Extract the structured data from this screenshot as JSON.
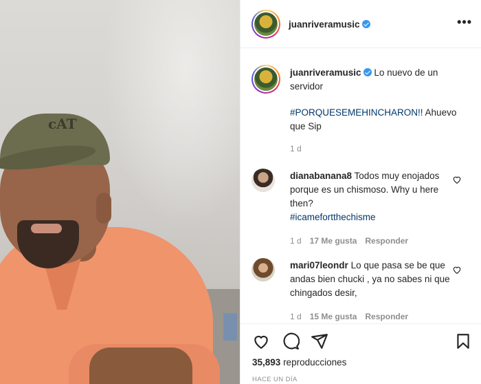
{
  "post": {
    "username": "juanriveramusic",
    "more_label": "•••"
  },
  "caption": {
    "username": "juanriveramusic",
    "text": "Lo nuevo de un servidor",
    "hashtag": "#PORQUESEMEHINCHARON!!",
    "text_after": "Ahuevo que Sip",
    "age": "1 d"
  },
  "comments": [
    {
      "username": "dianabanana8",
      "text": "Todos muy enojados porque es un chismoso. Why u here then?",
      "hashtag": "#icamefortthechisme",
      "age": "1 d",
      "likes": "17 Me gusta",
      "reply": "Responder"
    },
    {
      "username": "mari07leondr",
      "text": "Lo que pasa se be que andas bien chucki , ya no sabes ni que chingados desir,",
      "age": "1 d",
      "likes": "15 Me gusta",
      "reply": "Responder"
    }
  ],
  "stats": {
    "views_count": "35,893",
    "views_label": "reproducciones",
    "time_ago": "HACE UN DÍA"
  },
  "icons": {
    "like": "heart-icon",
    "comment": "comment-icon",
    "share": "share-icon",
    "save": "bookmark-icon"
  },
  "colors": {
    "verified": "#3897f0",
    "hashtag": "#00376b",
    "muted": "#8e8e8e"
  }
}
